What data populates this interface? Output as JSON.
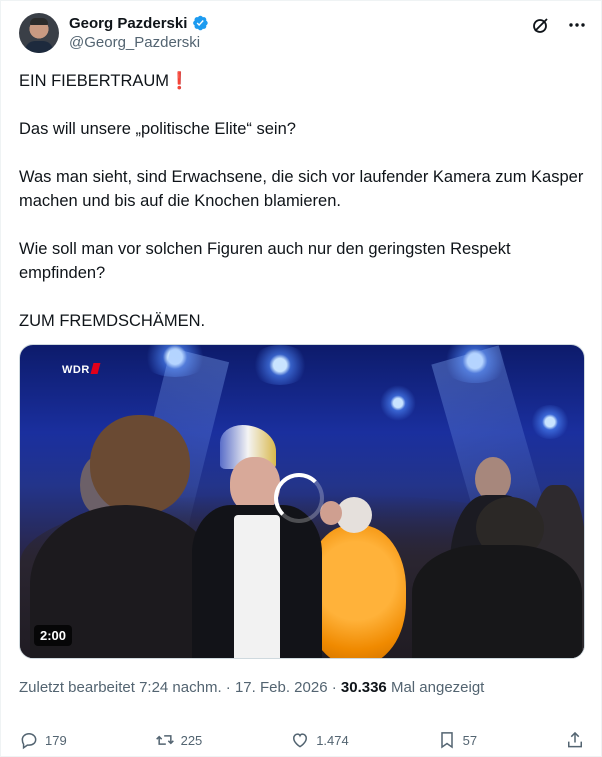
{
  "author": {
    "display_name": "Georg Pazderski",
    "handle": "@Georg_Pazderski",
    "verified": true
  },
  "header_icons": [
    "grok-icon",
    "more-icon"
  ],
  "tweet": {
    "paragraphs": [
      "EIN FIEBERTRAUM",
      "Das will unsere „politische Elite“ sein?",
      "Was man sieht, sind Erwachsene, die sich vor laufender Kamera zum Kasper machen und bis auf die Knochen blamieren.",
      "Wie soll man vor solchen Figuren auch nur den geringsten Respekt empfinden?",
      "ZUM FREMDSCHÄMEN."
    ],
    "emoji_mark": "❗"
  },
  "media": {
    "broadcaster": "WDR",
    "duration": "2:00"
  },
  "meta": {
    "edited_label": "Zuletzt bearbeitet 7:24 nachm.",
    "separator": "·",
    "date": "17. Feb. 2026",
    "views_count": "30.336",
    "views_label": "Mal angezeigt"
  },
  "actions": {
    "replies": "179",
    "reposts": "225",
    "likes": "1.474",
    "bookmarks": "57"
  },
  "colors": {
    "text": "#0f1419",
    "secondary": "#536471",
    "verified": "#1d9bf0",
    "border": "#eff3f4"
  }
}
